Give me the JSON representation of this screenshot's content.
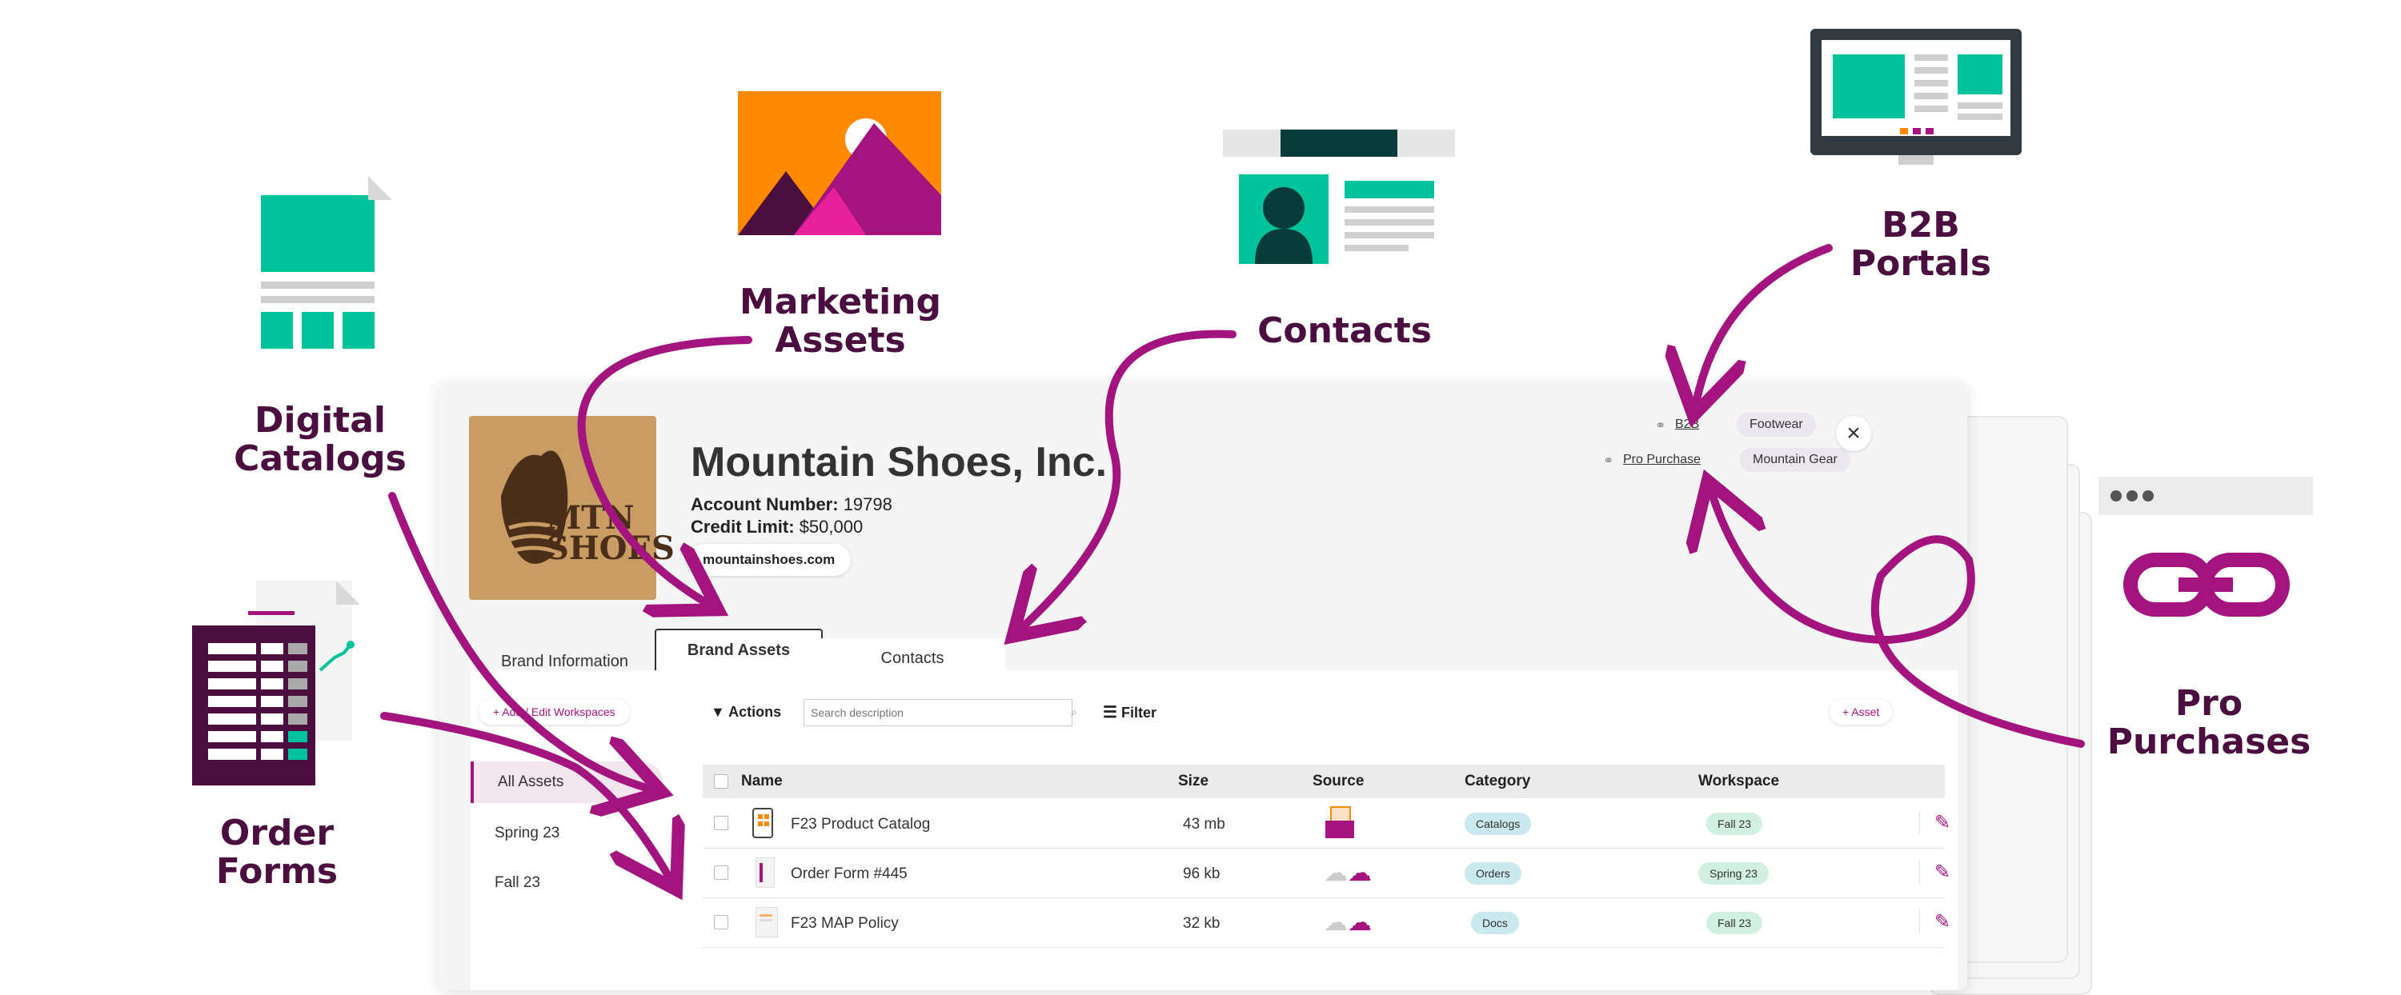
{
  "callouts": {
    "digital_catalogs": "Digital\nCatalogs",
    "marketing_assets": "Marketing\nAssets",
    "contacts": "Contacts",
    "b2b_portals": "B2B\nPortals",
    "order_forms": "Order\nForms",
    "pro_purchases": "Pro\nPurchases"
  },
  "company": {
    "name": "Mountain Shoes, Inc.",
    "account_label": "Account Number:",
    "account_value": "19798",
    "credit_label": "Credit Limit:",
    "credit_value": "$50,000",
    "website": "mountainshoes.com",
    "logo_text_1": "MTN",
    "logo_text_2": "SHOES"
  },
  "header_links": {
    "b2b": "B2B",
    "pro_purchase": "Pro Purchase",
    "tag_footwear": "Footwear",
    "tag_mountain_gear": "Mountain Gear"
  },
  "tabs": {
    "brand_information": "Brand Information",
    "brand_assets": "Brand Assets",
    "contacts": "Contacts"
  },
  "toolbar": {
    "add_edit_workspaces": "+ Add / Edit Workspaces",
    "actions": "Actions",
    "search_placeholder": "Search description",
    "filter": "Filter",
    "add_asset": "+ Asset"
  },
  "sidebar": {
    "items": [
      "All Assets",
      "Spring 23",
      "Fall 23"
    ]
  },
  "table": {
    "columns": [
      "Name",
      "Size",
      "Source",
      "Category",
      "Workspace"
    ],
    "rows": [
      {
        "name": "F23 Product Catalog",
        "size": "43 mb",
        "category": "Catalogs",
        "workspace": "Fall 23"
      },
      {
        "name": "Order Form #445",
        "size": "96 kb",
        "category": "Orders",
        "workspace": "Spring 23"
      },
      {
        "name": "F23 MAP Policy",
        "size": "32 kb",
        "category": "Docs",
        "workspace": "Fall 23"
      }
    ]
  },
  "colors": {
    "brand_purple": "#a3147f",
    "dark_purple": "#4a0f3f",
    "teal": "#00c39c",
    "category_chip": "#c9e9ee",
    "workspace_chip": "#d2f0e2"
  }
}
